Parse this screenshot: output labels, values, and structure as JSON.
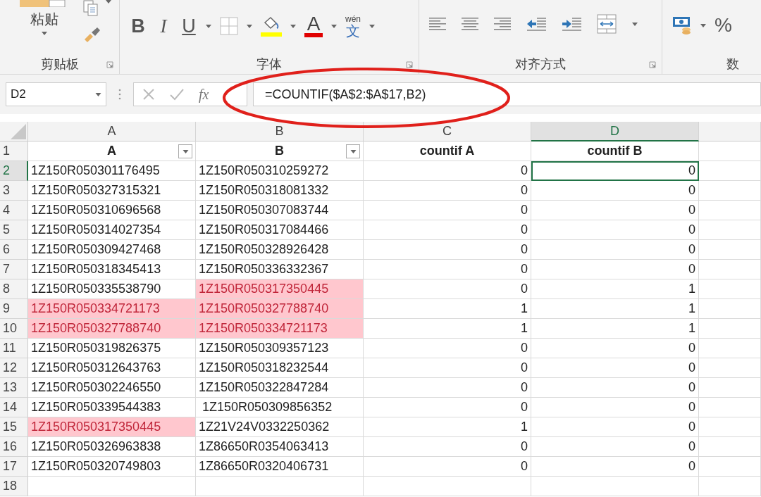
{
  "ribbon": {
    "groups": [
      {
        "kind": "clipboard",
        "label": "剪贴板",
        "paste_label": "粘贴"
      },
      {
        "kind": "font",
        "label": "字体",
        "bold": "B",
        "italic": "I",
        "underline": "U",
        "font_color": "A",
        "phonetic_top": "wén",
        "phonetic_char": "文"
      },
      {
        "kind": "alignment",
        "label": "对齐方式"
      },
      {
        "kind": "number",
        "label": "数",
        "percent": "%"
      }
    ]
  },
  "formula_bar": {
    "name_box": "D2",
    "fx": "fx",
    "formula": "=COUNTIF($A$2:$A$17,B2)"
  },
  "column_headers": [
    {
      "label": "A",
      "selected": false
    },
    {
      "label": "B",
      "selected": false
    },
    {
      "label": "C",
      "selected": false
    },
    {
      "label": "D",
      "selected": true
    }
  ],
  "header_row": {
    "row": "1",
    "selected": false,
    "cells": [
      {
        "text": "A",
        "filter": true
      },
      {
        "text": "B",
        "filter": true
      },
      {
        "text": "countif A",
        "filter": false
      },
      {
        "text": "countif B",
        "filter": false
      }
    ]
  },
  "rows": [
    {
      "row": "2",
      "selected": true,
      "a": {
        "text": "1Z150R050301176495",
        "highlighted": false
      },
      "b": {
        "text": "1Z150R050310259272",
        "highlighted": false
      },
      "c": "0",
      "d": {
        "text": "0",
        "selected": true
      }
    },
    {
      "row": "3",
      "selected": false,
      "a": {
        "text": "1Z150R050327315321",
        "highlighted": false
      },
      "b": {
        "text": "1Z150R050318081332",
        "highlighted": false
      },
      "c": "0",
      "d": {
        "text": "0",
        "selected": false
      }
    },
    {
      "row": "4",
      "selected": false,
      "a": {
        "text": "1Z150R050310696568",
        "highlighted": false
      },
      "b": {
        "text": "1Z150R050307083744",
        "highlighted": false
      },
      "c": "0",
      "d": {
        "text": "0",
        "selected": false
      }
    },
    {
      "row": "5",
      "selected": false,
      "a": {
        "text": "1Z150R050314027354",
        "highlighted": false
      },
      "b": {
        "text": "1Z150R050317084466",
        "highlighted": false
      },
      "c": "0",
      "d": {
        "text": "0",
        "selected": false
      }
    },
    {
      "row": "6",
      "selected": false,
      "a": {
        "text": "1Z150R050309427468",
        "highlighted": false
      },
      "b": {
        "text": "1Z150R050328926428",
        "highlighted": false
      },
      "c": "0",
      "d": {
        "text": "0",
        "selected": false
      }
    },
    {
      "row": "7",
      "selected": false,
      "a": {
        "text": "1Z150R050318345413",
        "highlighted": false
      },
      "b": {
        "text": "1Z150R050336332367",
        "highlighted": false
      },
      "c": "0",
      "d": {
        "text": "0",
        "selected": false
      }
    },
    {
      "row": "8",
      "selected": false,
      "a": {
        "text": "1Z150R050335538790",
        "highlighted": false
      },
      "b": {
        "text": "1Z150R050317350445",
        "highlighted": true
      },
      "c": "0",
      "d": {
        "text": "1",
        "selected": false
      }
    },
    {
      "row": "9",
      "selected": false,
      "a": {
        "text": "1Z150R050334721173",
        "highlighted": true
      },
      "b": {
        "text": "1Z150R050327788740",
        "highlighted": true
      },
      "c": "1",
      "d": {
        "text": "1",
        "selected": false
      }
    },
    {
      "row": "10",
      "selected": false,
      "a": {
        "text": "1Z150R050327788740",
        "highlighted": true
      },
      "b": {
        "text": "1Z150R050334721173",
        "highlighted": true
      },
      "c": "1",
      "d": {
        "text": "1",
        "selected": false
      }
    },
    {
      "row": "11",
      "selected": false,
      "a": {
        "text": "1Z150R050319826375",
        "highlighted": false
      },
      "b": {
        "text": "1Z150R050309357123",
        "highlighted": false
      },
      "c": "0",
      "d": {
        "text": "0",
        "selected": false
      }
    },
    {
      "row": "12",
      "selected": false,
      "a": {
        "text": "1Z150R050312643763",
        "highlighted": false
      },
      "b": {
        "text": "1Z150R050318232544",
        "highlighted": false
      },
      "c": "0",
      "d": {
        "text": "0",
        "selected": false
      }
    },
    {
      "row": "13",
      "selected": false,
      "a": {
        "text": "1Z150R050302246550",
        "highlighted": false
      },
      "b": {
        "text": "1Z150R050322847284",
        "highlighted": false
      },
      "c": "0",
      "d": {
        "text": "0",
        "selected": false
      }
    },
    {
      "row": "14",
      "selected": false,
      "a": {
        "text": "1Z150R050339544383",
        "highlighted": false
      },
      "b": {
        "text": " 1Z150R050309856352",
        "highlighted": false
      },
      "c": "0",
      "d": {
        "text": "0",
        "selected": false
      }
    },
    {
      "row": "15",
      "selected": false,
      "a": {
        "text": "1Z150R050317350445",
        "highlighted": true
      },
      "b": {
        "text": "1Z21V24V0332250362",
        "highlighted": false
      },
      "c": "1",
      "d": {
        "text": "0",
        "selected": false
      }
    },
    {
      "row": "16",
      "selected": false,
      "a": {
        "text": "1Z150R050326963838",
        "highlighted": false
      },
      "b": {
        "text": "1Z86650R0354063413",
        "highlighted": false
      },
      "c": "0",
      "d": {
        "text": "0",
        "selected": false
      }
    },
    {
      "row": "17",
      "selected": false,
      "a": {
        "text": "1Z150R050320749803",
        "highlighted": false
      },
      "b": {
        "text": "1Z86650R0320406731",
        "highlighted": false
      },
      "c": "0",
      "d": {
        "text": "0",
        "selected": false
      }
    },
    {
      "row": "18",
      "selected": false
    }
  ]
}
